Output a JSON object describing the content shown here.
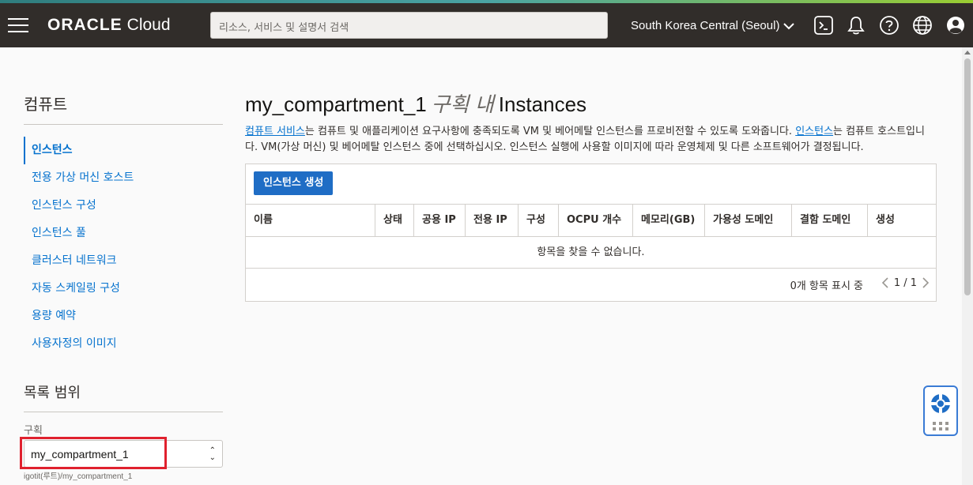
{
  "header": {
    "brand": "ORACLE",
    "brand_sub": "Cloud",
    "search_placeholder": "리소스, 서비스 및 설명서 검색",
    "region": "South Korea Central (Seoul)"
  },
  "sidebar": {
    "title": "컴퓨트",
    "items": [
      {
        "label": "인스턴스",
        "active": true
      },
      {
        "label": "전용 가상 머신 호스트"
      },
      {
        "label": "인스턴스 구성"
      },
      {
        "label": "인스턴스 풀"
      },
      {
        "label": "클러스터 네트워크"
      },
      {
        "label": "자동 스케일링 구성"
      },
      {
        "label": "용량 예약"
      },
      {
        "label": "사용자정의 이미지"
      }
    ],
    "scope_title": "목록 범위",
    "compartment_label": "구획",
    "compartment_value": "my_compartment_1",
    "compartment_path": "igotit(루트)/my_compartment_1"
  },
  "main": {
    "title_compartment": "my_compartment_1",
    "title_in": "구획 내",
    "title_resource": "Instances",
    "desc_link1": "컴퓨트 서비스",
    "desc_part1": "는 컴퓨트 및 애플리케이션 요구사항에 충족되도록 VM 및 베어메탈 인스턴스를 프로비전할 수 있도록 도와줍니다. ",
    "desc_link2": "인스턴스",
    "desc_part2": "는 컴퓨트 호스트입니다. VM(가상 머신) 및 베어메탈 인스턴스 중에 선택하십시오. 인스턴스 실행에 사용할 이미지에 따라 운영체제 및 다른 소프트웨어가 결정됩니다.",
    "create_button": "인스턴스 생성",
    "columns": [
      "이름",
      "상태",
      "공용 IP",
      "전용 IP",
      "구성",
      "OCPU 개수",
      "메모리(GB)",
      "가용성 도메인",
      "결함 도메인",
      "생성"
    ],
    "empty_text": "항목을 찾을 수 없습니다.",
    "count_text": "0개 항목 표시 중",
    "page_text": "1 / 1"
  },
  "colors": {
    "topbar": "#312d2a",
    "link": "#0572ce",
    "primary_button": "#1f6dc5",
    "highlight": "#e0212e"
  },
  "icons": [
    "hamburger-menu-icon",
    "chevron-down-icon",
    "cloud-shell-icon",
    "bell-icon",
    "help-icon",
    "globe-icon",
    "user-icon",
    "lifebuoy-icon"
  ]
}
